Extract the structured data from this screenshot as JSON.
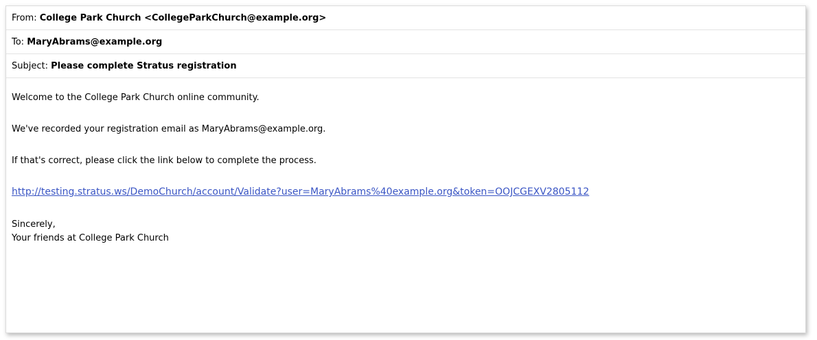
{
  "header": {
    "from_label": "From:",
    "from_value": "College Park Church <CollegeParkChurch@example.org>",
    "to_label": "To:",
    "to_value": "MaryAbrams@example.org",
    "subject_label": "Subject:",
    "subject_value": "Please complete Stratus registration"
  },
  "body": {
    "welcome": "Welcome to the College Park Church online community.",
    "recorded": "We've recorded your registration email as MaryAbrams@example.org.",
    "instruction": "If that's correct, please click the link below to complete the process.",
    "link_text": "http://testing.stratus.ws/DemoChurch/account/Validate?user=MaryAbrams%40example.org&token=OOJCGEXV2805112",
    "closing": "Sincerely,",
    "signature": "Your friends at College Park Church"
  },
  "colors": {
    "link": "#3a55c4",
    "divider": "#e3e3e3"
  }
}
